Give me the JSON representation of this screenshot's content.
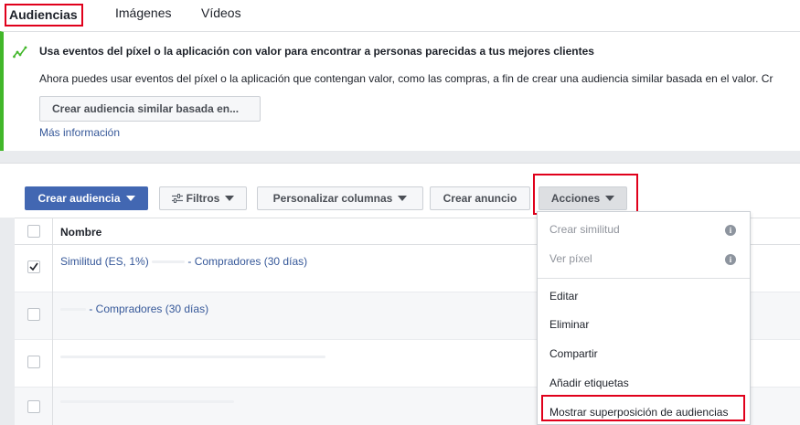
{
  "tabs": [
    {
      "label": "Audiencias"
    },
    {
      "label": "Imágenes"
    },
    {
      "label": "Vídeos"
    }
  ],
  "notice": {
    "title": "Usa eventos del píxel o la aplicación con valor para encontrar a personas parecidas a tus mejores clientes",
    "text": "Ahora puedes usar eventos del píxel o la aplicación que contengan valor, como las compras, a fin de crear una audiencia similar basada en el valor. Cr",
    "button": "Crear audiencia similar basada en...",
    "link": "Más información",
    "accent_color": "#42b72a"
  },
  "toolbar": {
    "create": "Crear audiencia",
    "filters": "Filtros",
    "columns": "Personalizar columnas",
    "ad": "Crear anuncio",
    "actions": "Acciones"
  },
  "table": {
    "header_name": "Nombre",
    "rows": [
      {
        "name_prefix": "Similitud (ES, 1%)",
        "name_suffix": "- Compradores (30 días)",
        "checked": true
      },
      {
        "name_prefix": "",
        "name_suffix": "- Compradores (30 días)",
        "checked": false
      },
      {
        "name_prefix": "",
        "name_suffix": "",
        "checked": false
      },
      {
        "name_prefix": "",
        "name_suffix": "",
        "checked": false
      }
    ]
  },
  "menu": {
    "items": [
      {
        "label": "Crear similitud",
        "disabled": true,
        "icon": "info-icon"
      },
      {
        "label": "Ver píxel",
        "disabled": true,
        "icon": "info-icon"
      },
      {
        "label": "Editar",
        "disabled": false
      },
      {
        "label": "Eliminar",
        "disabled": false
      },
      {
        "label": "Compartir",
        "disabled": false
      },
      {
        "label": "Añadir etiquetas",
        "disabled": false
      },
      {
        "label": "Mostrar superposición de audiencias",
        "disabled": false
      }
    ]
  },
  "colors": {
    "primary": "#4267b2",
    "link": "#365899",
    "highlight": "#e0001b"
  }
}
